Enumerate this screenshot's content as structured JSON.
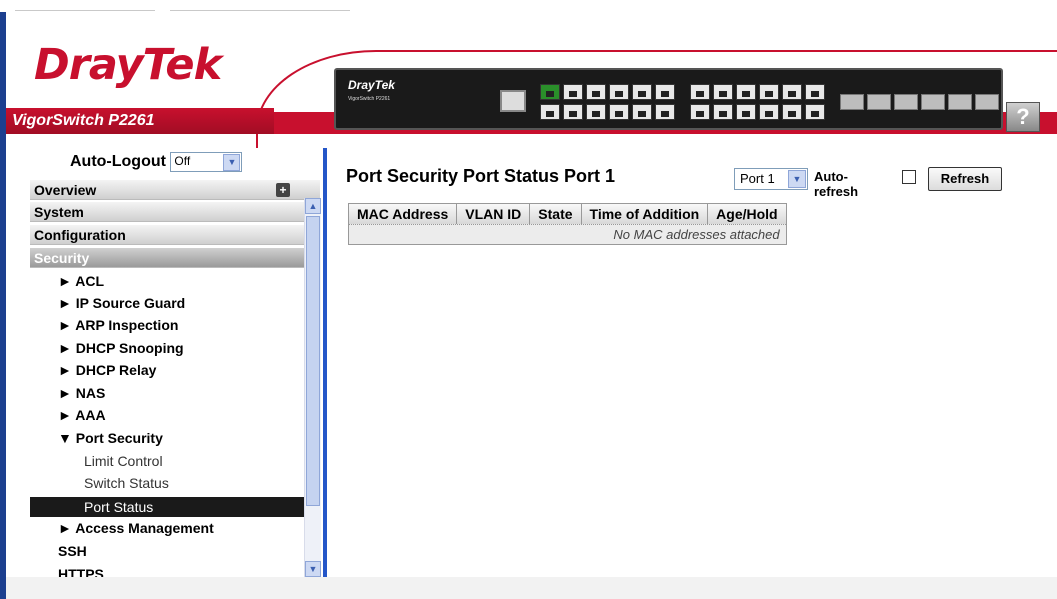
{
  "header": {
    "logo": {
      "dray": "Dray",
      "tek": "Tek"
    },
    "model": "VigorSwitch P2261",
    "device_brand": "DrayTek",
    "device_model": "VigorSwitch P2261",
    "help": "?"
  },
  "sidebar": {
    "autologout_label": "Auto-Logout",
    "autologout_value": "Off",
    "sections": {
      "overview": "Overview",
      "system": "System",
      "configuration": "Configuration",
      "security": "Security"
    },
    "items": [
      "► ACL",
      "► IP Source Guard",
      "► ARP Inspection",
      "► DHCP Snooping",
      "► DHCP Relay",
      "► NAS",
      "► AAA",
      "▼ Port Security"
    ],
    "sub_items": [
      "Limit Control",
      "Switch Status",
      "Port Status"
    ],
    "after": [
      "► Access Management",
      "SSH",
      "HTTPS"
    ]
  },
  "main": {
    "title": "Port Security Port Status  Port 1",
    "port_select": "Port 1",
    "autorefresh_label": "Auto-refresh",
    "refresh_label": "Refresh",
    "table": {
      "columns": [
        "MAC Address",
        "VLAN ID",
        "State",
        "Time of Addition",
        "Age/Hold"
      ],
      "empty": "No MAC addresses attached"
    }
  }
}
